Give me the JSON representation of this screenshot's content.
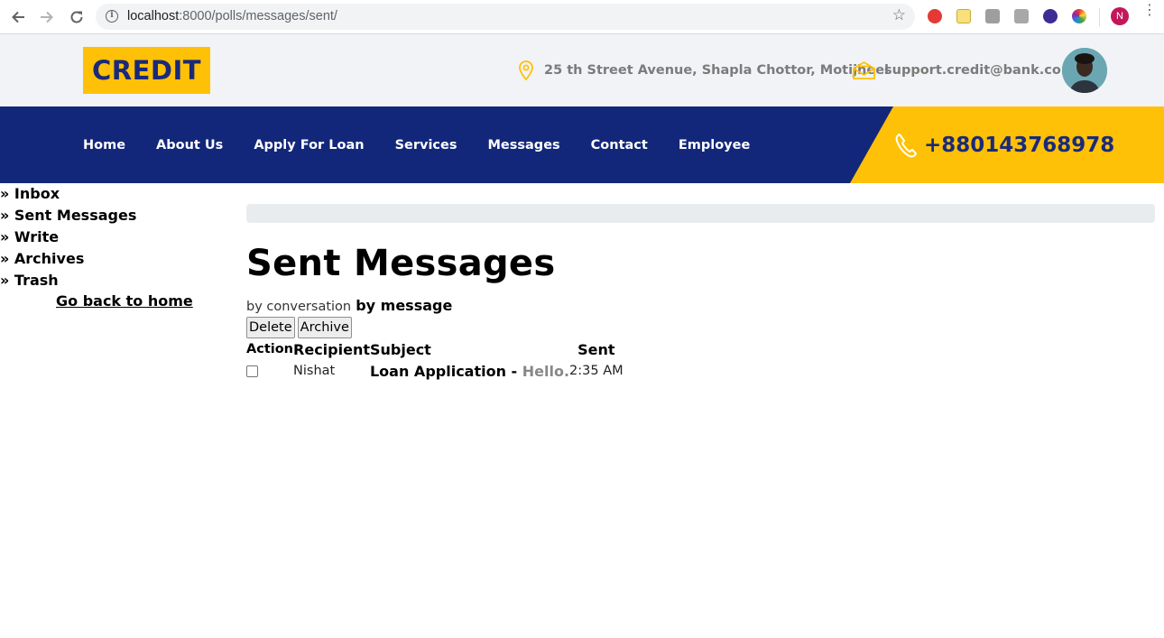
{
  "browser": {
    "url_host": "localhost",
    "url_rest": ":8000/polls/messages/sent/",
    "profile_initial": "N"
  },
  "site": {
    "logo": "CREDIT",
    "address": "25 th Street Avenue, Shapla Chottor, Motijheel",
    "email": "support.credit@bank.com",
    "phone": "+880143768978",
    "colors": {
      "navy": "#13277a",
      "yellow": "#ffc107"
    }
  },
  "nav": {
    "items": [
      "Home",
      "About Us",
      "Apply For Loan",
      "Services",
      "Messages",
      "Contact",
      "Employee"
    ]
  },
  "sidebar": {
    "items": [
      "» Inbox",
      "» Sent Messages",
      "» Write",
      "» Archives",
      "» Trash"
    ],
    "back_home": "Go back to home"
  },
  "main": {
    "title": "Sent Messages",
    "view_conversation": "by conversation",
    "view_message": "by message",
    "delete_label": "Delete",
    "archive_label": "Archive",
    "columns": {
      "action": "Action",
      "recipient": "Recipient",
      "subject": "Subject",
      "sent": "Sent"
    },
    "rows": [
      {
        "recipient": "Nishat",
        "subject": "Loan Application",
        "separator": " - ",
        "preview": "Hello.",
        "sent": "2:35 AM",
        "checked": false
      }
    ]
  }
}
